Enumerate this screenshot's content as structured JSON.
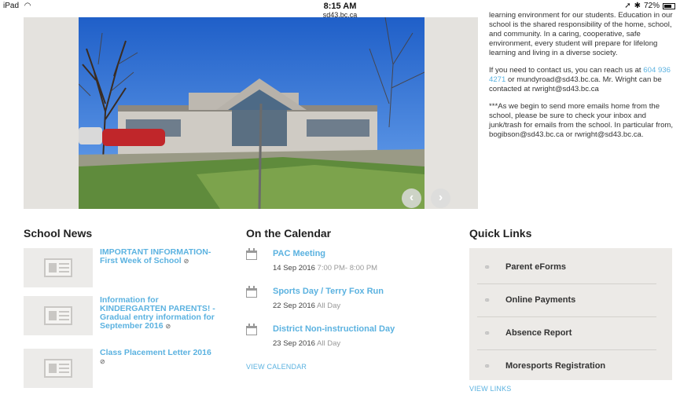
{
  "status_bar": {
    "device": "iPad",
    "time": "8:15 AM",
    "url": "sd43.bc.ca",
    "battery": "72%",
    "battery_level": 0.72
  },
  "hero": {
    "prev_arrow": "‹",
    "next_arrow": "›"
  },
  "intro": {
    "p1": "learning environment for our students. Education in our school is the shared responsibility of the home, school, and community. In a caring, cooperative, safe environment, every student will prepare for lifelong learning and living in a diverse society.",
    "p2_start": "If you need to contact us, you can reach us at",
    "phone": "604 936 4271",
    "p2_end": "or mundyroad@sd43.bc.ca. Mr. Wright can be contacted at rwright@sd43.bc.ca",
    "p3": "***As we begin to send more emails home from the school, please be sure to check your inbox and junk/trash for emails from the school. In particular from,  bogibson@sd43.bc.ca or rwright@sd43.bc.ca."
  },
  "school_news": {
    "title": "School News",
    "items": [
      {
        "title": "IMPORTANT INFORMATION- First Week of School"
      },
      {
        "title": "Information for KINDERGARTEN PARENTS! - Gradual entry information for September 2016"
      },
      {
        "title": "Class Placement Letter 2016"
      }
    ]
  },
  "calendar": {
    "title": "On the Calendar",
    "events": [
      {
        "title": "PAC Meeting",
        "date": "14 Sep 2016",
        "time": "7:00 PM- 8:00 PM"
      },
      {
        "title": "Sports Day / Terry Fox Run",
        "date": "22 Sep 2016",
        "time": "All Day"
      },
      {
        "title": "District Non-instructional Day",
        "date": "23 Sep 2016",
        "time": "All Day"
      }
    ],
    "view_label": "VIEW CALENDAR"
  },
  "quick_links": {
    "title": "Quick Links",
    "items": [
      {
        "label": "Parent eForms"
      },
      {
        "label": "Online Payments"
      },
      {
        "label": "Absence Report"
      },
      {
        "label": "Moresports Registration"
      }
    ],
    "view_label": "VIEW LINKS"
  },
  "icons": {
    "link": "link-icon",
    "calendar": "calendar-icon",
    "attachment": "paperclip-icon"
  },
  "colors": {
    "link": "#5bb2e0",
    "panel": "#eceae7"
  }
}
